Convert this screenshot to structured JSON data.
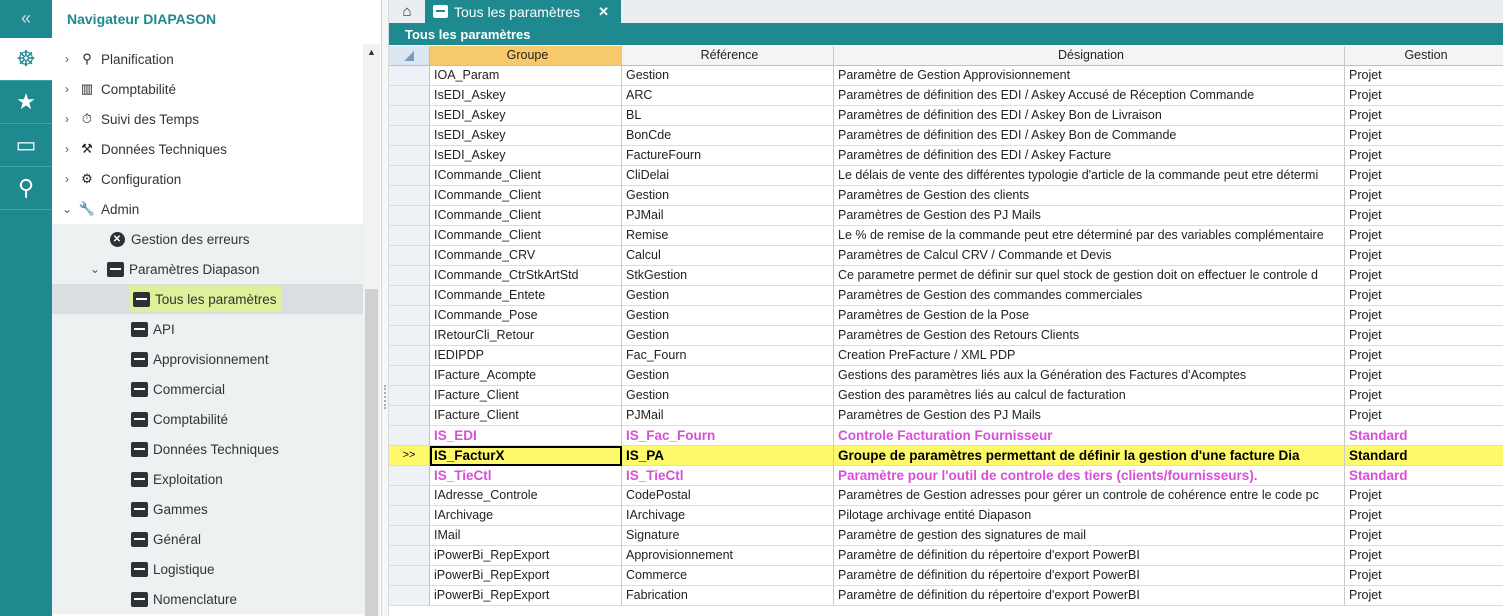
{
  "nav": {
    "title": "Navigateur DIAPASON",
    "items": [
      {
        "label": "Planification",
        "icon": "binoculars-icon",
        "glyph": "⚲",
        "chev": "›"
      },
      {
        "label": "Comptabilité",
        "icon": "chart-icon",
        "glyph": "▥",
        "chev": "›"
      },
      {
        "label": "Suivi des Temps",
        "icon": "stopwatch-icon",
        "glyph": "⏱",
        "chev": "›"
      },
      {
        "label": "Données Techniques",
        "icon": "tools-icon",
        "glyph": "⚒",
        "chev": "›"
      },
      {
        "label": "Configuration",
        "icon": "gear-icon",
        "glyph": "⚙",
        "chev": "›"
      },
      {
        "label": "Admin",
        "icon": "wrench-icon",
        "glyph": "🔧",
        "chev": "⌄"
      }
    ],
    "admin_children": [
      {
        "label": "Gestion des erreurs"
      },
      {
        "label": "Paramètres Diapason"
      }
    ],
    "param_children": [
      {
        "label": "Tous les paramètres"
      },
      {
        "label": "API"
      },
      {
        "label": "Approvisionnement"
      },
      {
        "label": "Commercial"
      },
      {
        "label": "Comptabilité"
      },
      {
        "label": "Données Techniques"
      },
      {
        "label": "Exploitation"
      },
      {
        "label": "Gammes"
      },
      {
        "label": "Général"
      },
      {
        "label": "Logistique"
      },
      {
        "label": "Nomenclature"
      }
    ]
  },
  "rail": {
    "collapse": "«",
    "icons": [
      "helm-icon",
      "star-icon",
      "monitor-icon",
      "search-icon"
    ]
  },
  "tabs": [
    {
      "label": "Tous les paramètres",
      "close": "✕"
    }
  ],
  "header": {
    "title": "Tous les paramètres"
  },
  "grid": {
    "columns": [
      "Groupe",
      "Référence",
      "Désignation",
      "Gestion"
    ],
    "rows": [
      {
        "g": "IOA_Param",
        "r": "Gestion",
        "d": "Paramètre de Gestion Approvisionnement",
        "m": "Projet"
      },
      {
        "g": "IsEDI_Askey",
        "r": "ARC",
        "d": "Paramètres de définition des EDI / Askey Accusé de Réception Commande",
        "m": "Projet"
      },
      {
        "g": "IsEDI_Askey",
        "r": "BL",
        "d": "Paramètres de définition des EDI / Askey Bon de Livraison",
        "m": "Projet"
      },
      {
        "g": "IsEDI_Askey",
        "r": "BonCde",
        "d": "Paramètres de définition des EDI / Askey Bon de Commande",
        "m": "Projet"
      },
      {
        "g": "IsEDI_Askey",
        "r": "FactureFourn",
        "d": "Paramètres de définition des EDI / Askey Facture",
        "m": "Projet"
      },
      {
        "g": "ICommande_Client",
        "r": "CliDelai",
        "d": "Le délais de vente des différentes typologie d'article de la commande peut etre détermi",
        "m": "Projet"
      },
      {
        "g": "ICommande_Client",
        "r": "Gestion",
        "d": "Paramètres de Gestion des clients",
        "m": "Projet"
      },
      {
        "g": "ICommande_Client",
        "r": "PJMail",
        "d": "Paramètres de Gestion des PJ Mails",
        "m": "Projet"
      },
      {
        "g": "ICommande_Client",
        "r": "Remise",
        "d": "Le % de remise de la commande peut etre déterminé par des variables complémentaire",
        "m": "Projet"
      },
      {
        "g": "ICommande_CRV",
        "r": "Calcul",
        "d": "Paramètres de Calcul CRV / Commande et Devis",
        "m": "Projet"
      },
      {
        "g": "ICommande_CtrStkArtStd",
        "r": "StkGestion",
        "d": "Ce parametre permet de définir sur quel stock de gestion doit on effectuer le controle d",
        "m": "Projet"
      },
      {
        "g": "ICommande_Entete",
        "r": "Gestion",
        "d": "Paramètres de Gestion des commandes commerciales",
        "m": "Projet"
      },
      {
        "g": "ICommande_Pose",
        "r": "Gestion",
        "d": "Paramètres de Gestion de la Pose",
        "m": "Projet"
      },
      {
        "g": "IRetourCli_Retour",
        "r": "Gestion",
        "d": "Paramètres de Gestion des Retours Clients",
        "m": "Projet"
      },
      {
        "g": "IEDIPDP",
        "r": "Fac_Fourn",
        "d": "Creation PreFacture / XML PDP",
        "m": "Projet"
      },
      {
        "g": "IFacture_Acompte",
        "r": "Gestion",
        "d": "Gestions des paramètres liés aux la Génération des Factures d'Acomptes",
        "m": "Projet"
      },
      {
        "g": "IFacture_Client",
        "r": "Gestion",
        "d": "Gestion des paramètres liés au calcul de facturation",
        "m": "Projet"
      },
      {
        "g": "IFacture_Client",
        "r": "PJMail",
        "d": "Paramètres de Gestion des PJ Mails",
        "m": "Projet"
      },
      {
        "g": "IS_EDI",
        "r": "IS_Fac_Fourn",
        "d": "Controle Facturation Fournisseur",
        "m": "Standard",
        "style": "std"
      },
      {
        "g": "IS_FacturX",
        "r": "IS_PA",
        "d": "Groupe de paramètres permettant de définir la gestion d'une facture Dia",
        "m": "Standard",
        "style": "cur",
        "marker": ">>"
      },
      {
        "g": "IS_TieCtl",
        "r": "IS_TieCtl",
        "d": "Paramètre pour l'outil de controle des tiers (clients/fournisseurs).",
        "m": "Standard",
        "style": "std"
      },
      {
        "g": "IAdresse_Controle",
        "r": "CodePostal",
        "d": "Paramètres de Gestion adresses pour gérer un controle de cohérence entre le code pc",
        "m": "Projet"
      },
      {
        "g": "IArchivage",
        "r": "IArchivage",
        "d": "Pilotage archivage entité Diapason",
        "m": "Projet"
      },
      {
        "g": "IMail",
        "r": "Signature",
        "d": "Paramètre de gestion des signatures de mail",
        "m": "Projet"
      },
      {
        "g": "iPowerBi_RepExport",
        "r": "Approvisionnement",
        "d": "Paramètre de définition du répertoire d'export PowerBI",
        "m": "Projet"
      },
      {
        "g": "iPowerBi_RepExport",
        "r": "Commerce",
        "d": "Paramètre de définition du répertoire d'export PowerBI",
        "m": "Projet"
      },
      {
        "g": "iPowerBi_RepExport",
        "r": "Fabrication",
        "d": "Paramètre de définition du répertoire d'export PowerBI",
        "m": "Projet"
      }
    ]
  }
}
